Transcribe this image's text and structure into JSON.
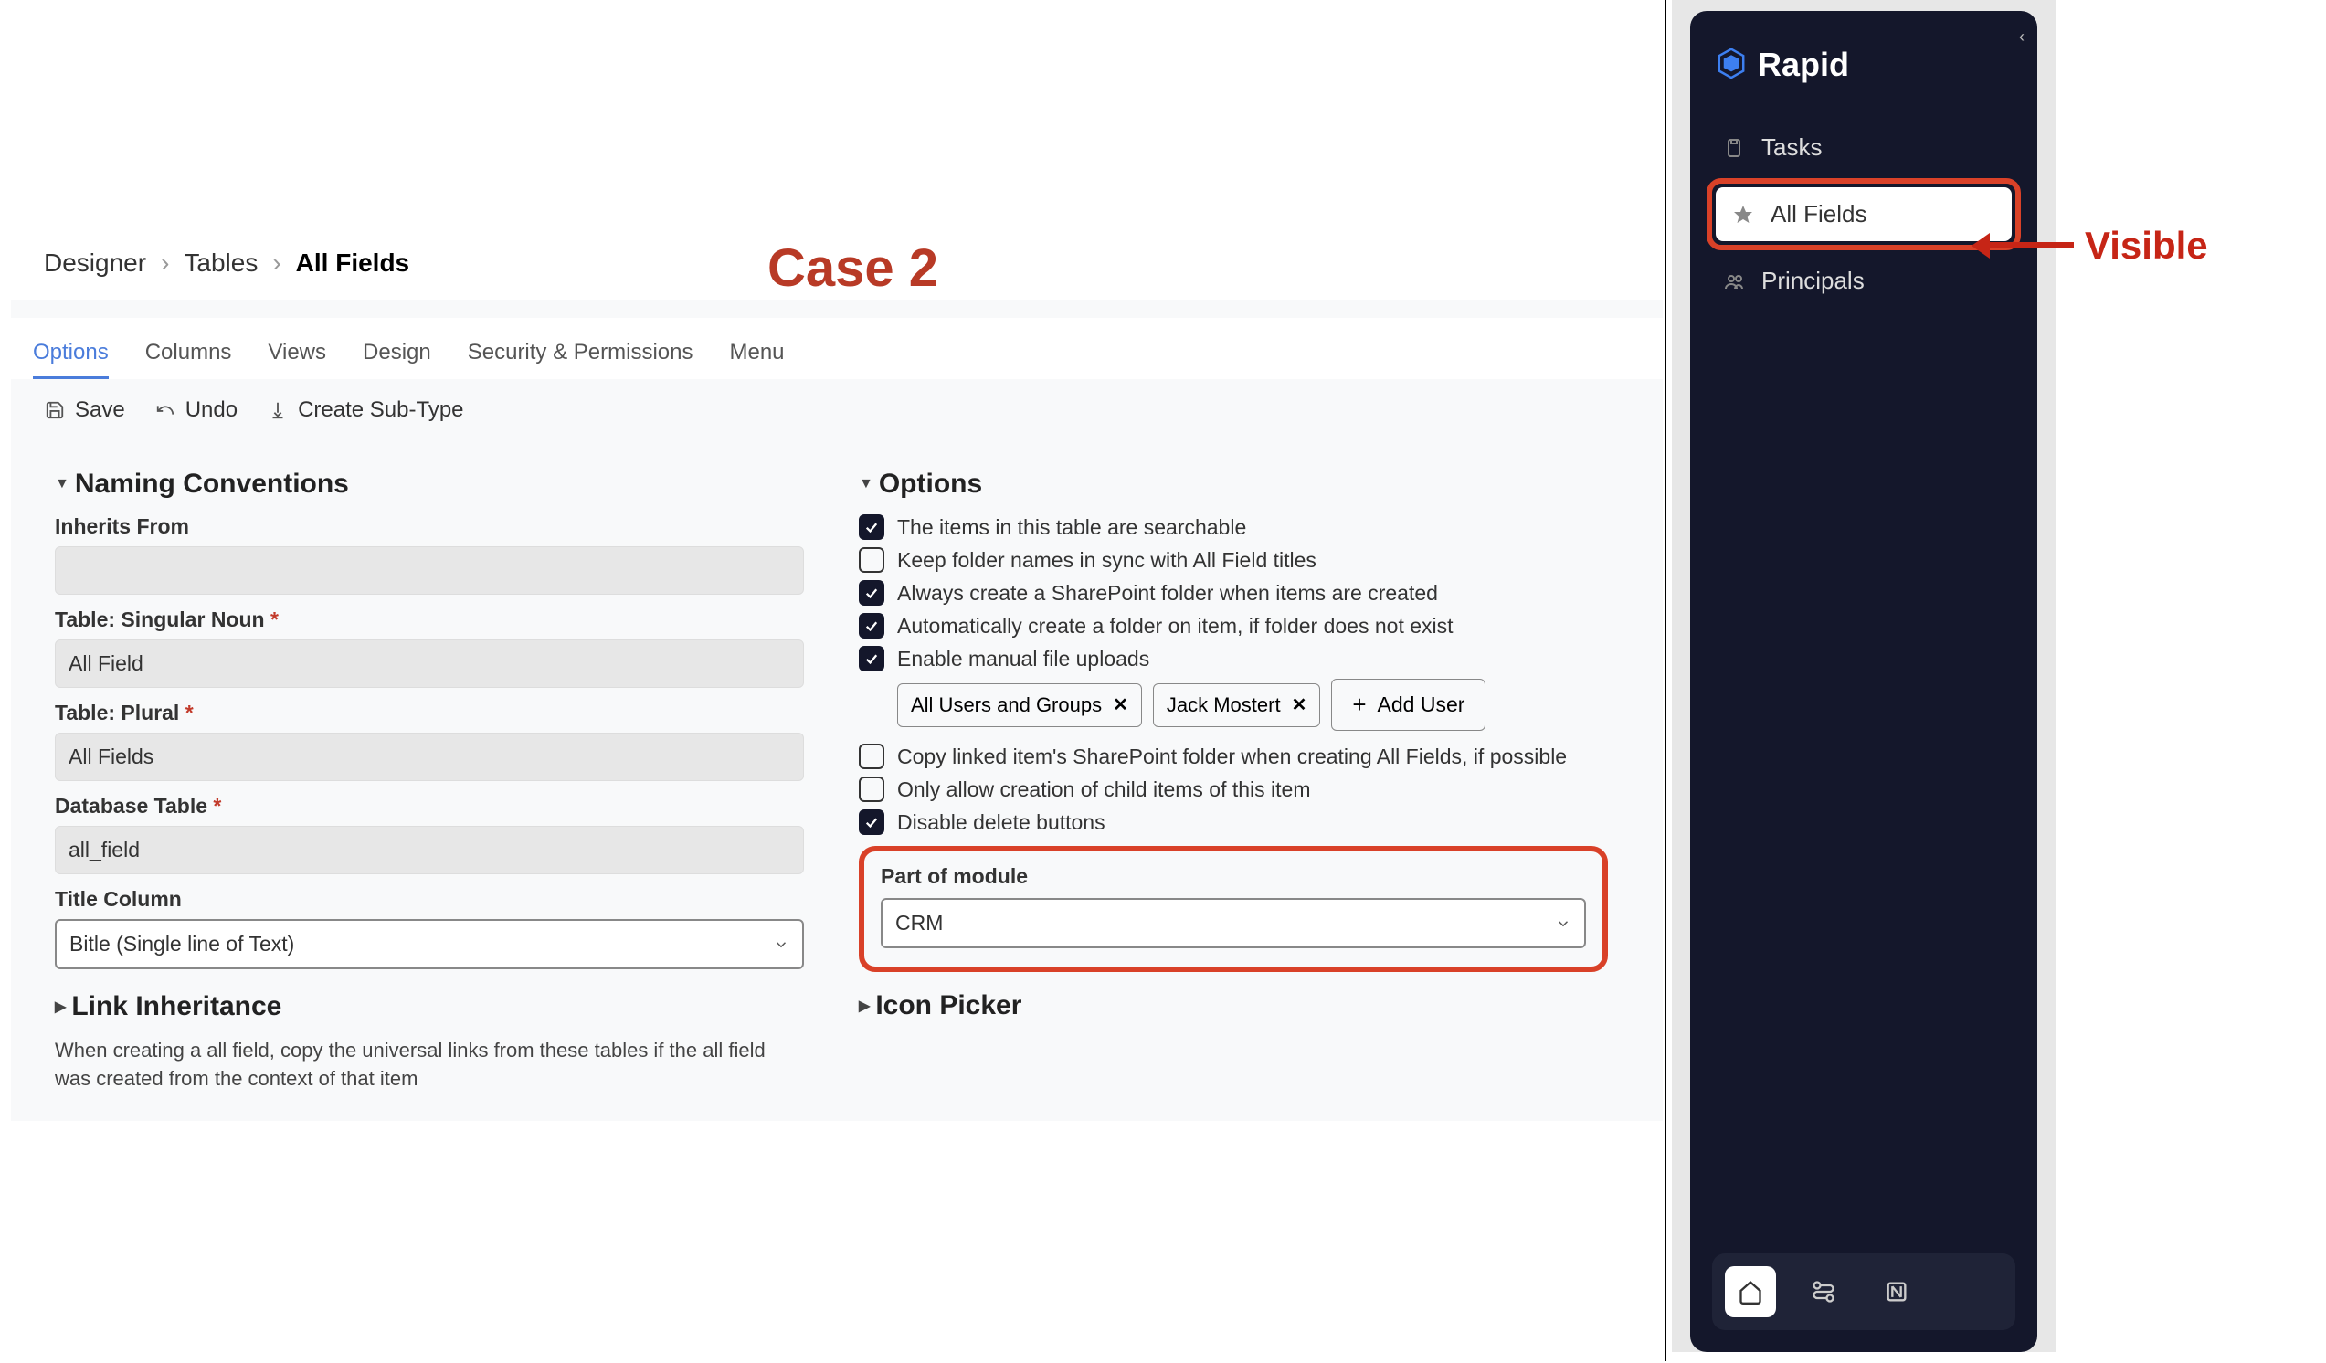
{
  "annotations": {
    "case_label": "Case 2",
    "visible_label": "Visible"
  },
  "breadcrumb": {
    "items": [
      "Designer",
      "Tables",
      "All Fields"
    ]
  },
  "tabs": {
    "items": [
      "Options",
      "Columns",
      "Views",
      "Design",
      "Security & Permissions",
      "Menu"
    ],
    "active": 0
  },
  "actions": {
    "save": "Save",
    "undo": "Undo",
    "create_subtype": "Create Sub-Type"
  },
  "left_panel": {
    "naming_header": "Naming Conventions",
    "inherits_label": "Inherits From",
    "inherits_value": "",
    "singular_label": "Table: Singular Noun",
    "singular_value": "All Field",
    "plural_label": "Table: Plural",
    "plural_value": "All Fields",
    "db_label": "Database Table",
    "db_value": "all_field",
    "title_col_label": "Title Column",
    "title_col_value": "Bitle (Single line of Text)",
    "link_header": "Link Inheritance",
    "link_desc": "When creating a all field, copy the universal links from these tables if the all field was created from the context of that item"
  },
  "right_panel": {
    "options_header": "Options",
    "checks": [
      {
        "checked": true,
        "label": "The items in this table are searchable"
      },
      {
        "checked": false,
        "label": "Keep folder names in sync with All Field titles"
      },
      {
        "checked": true,
        "label": "Always create a SharePoint folder when items are created"
      },
      {
        "checked": true,
        "label": "Automatically create a folder on item, if folder does not exist"
      },
      {
        "checked": true,
        "label": "Enable manual file uploads"
      }
    ],
    "chips": [
      "All Users and Groups",
      "Jack Mostert"
    ],
    "add_user": "Add User",
    "checks2": [
      {
        "checked": false,
        "label": "Copy linked item's SharePoint folder when creating All Fields, if possible"
      },
      {
        "checked": false,
        "label": "Only allow creation of child items of this item"
      },
      {
        "checked": true,
        "label": "Disable delete buttons"
      }
    ],
    "module_label": "Part of module",
    "module_value": "CRM",
    "icon_picker_header": "Icon Picker"
  },
  "sidebar": {
    "brand": "Rapid",
    "items": [
      {
        "icon": "clipboard",
        "label": "Tasks",
        "active": false
      },
      {
        "icon": "star",
        "label": "All Fields",
        "active": true
      },
      {
        "icon": "people",
        "label": "Principals",
        "active": false
      }
    ]
  }
}
